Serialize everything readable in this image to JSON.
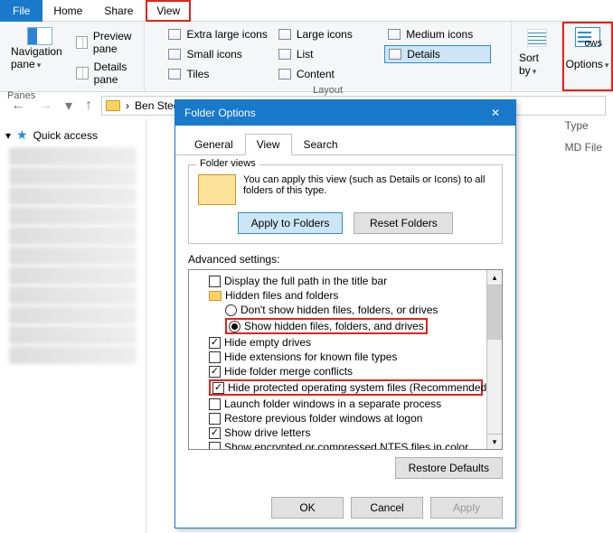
{
  "ribbon_tabs": {
    "file": "File",
    "home": "Home",
    "share": "Share",
    "view": "View"
  },
  "ribbon": {
    "panes": {
      "navigation": "Navigation pane",
      "preview": "Preview pane",
      "details": "Details pane",
      "group_label": "Panes"
    },
    "layout": {
      "extra_large": "Extra large icons",
      "large": "Large icons",
      "medium": "Medium icons",
      "small": "Small icons",
      "list": "List",
      "details": "Details",
      "tiles": "Tiles",
      "content": "Content",
      "group_label": "Layout"
    },
    "sort": {
      "label": "Sort by"
    },
    "options": {
      "label": "Options"
    }
  },
  "address": {
    "path_segment": "Ben Steg",
    "chevron": "›"
  },
  "tree": {
    "quick_access": "Quick access"
  },
  "columns": {
    "type": "Type",
    "md_file": "MD File"
  },
  "dialog": {
    "title": "Folder Options",
    "tabs": {
      "general": "General",
      "view": "View",
      "search": "Search"
    },
    "folder_views": {
      "group": "Folder views",
      "desc": "You can apply this view (such as Details or Icons) to all folders of this type.",
      "apply": "Apply to Folders",
      "reset": "Reset Folders"
    },
    "advanced_label": "Advanced settings:",
    "items": {
      "display_full_path": "Display the full path in the title bar",
      "hidden_folder": "Hidden files and folders",
      "dont_show_hidden": "Don't show hidden files, folders, or drives",
      "show_hidden": "Show hidden files, folders, and drives",
      "hide_empty": "Hide empty drives",
      "hide_ext": "Hide extensions for known file types",
      "hide_merge": "Hide folder merge conflicts",
      "hide_protected": "Hide protected operating system files (Recommended)",
      "launch_separate": "Launch folder windows in a separate process",
      "restore_previous": "Restore previous folder windows at logon",
      "show_drive_letters": "Show drive letters",
      "show_encrypted": "Show encrypted or compressed NTFS files in color"
    },
    "restore_defaults": "Restore Defaults",
    "ok": "OK",
    "cancel": "Cancel",
    "apply": "Apply"
  }
}
